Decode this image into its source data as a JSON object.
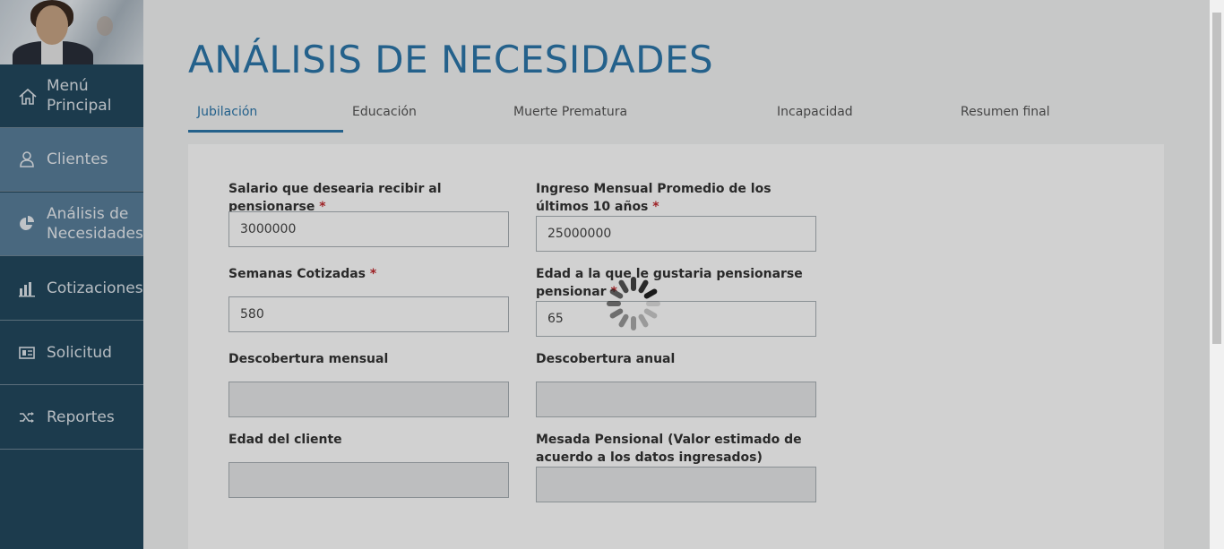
{
  "sidebar": {
    "items": [
      {
        "label": "Menú Principal",
        "icon": "home-icon"
      },
      {
        "label": "Clientes",
        "icon": "user-icon"
      },
      {
        "label": "Análisis de Necesidades",
        "icon": "pie-chart-icon"
      },
      {
        "label": "Cotizaciones",
        "icon": "bar-chart-icon"
      },
      {
        "label": "Solicitud",
        "icon": "form-icon"
      },
      {
        "label": "Reportes",
        "icon": "shuffle-icon"
      }
    ]
  },
  "page": {
    "title": "ANÁLISIS DE NECESIDADES"
  },
  "tabs": [
    {
      "label": "Jubilación",
      "active": true
    },
    {
      "label": "Educación",
      "active": false
    },
    {
      "label": "Muerte Prematura",
      "active": false
    },
    {
      "label": "Incapacidad",
      "active": false
    },
    {
      "label": "Resumen final",
      "active": false
    }
  ],
  "form": {
    "required_mark": "*",
    "salario": {
      "label": "Salario que desearia recibir al pensionarse",
      "value": "3000000"
    },
    "ingreso": {
      "label": "Ingreso Mensual Promedio de los últimos 10 años",
      "value": "25000000"
    },
    "semanas": {
      "label": "Semanas Cotizadas",
      "value": "580"
    },
    "edad_pension": {
      "label": "Edad a la que le gustaria pensionarse pensionar",
      "value": "65"
    },
    "desc_mensual": {
      "label": "Descobertura mensual",
      "value": ""
    },
    "desc_anual": {
      "label": "Descobertura anual",
      "value": ""
    },
    "edad_cliente": {
      "label": "Edad del cliente",
      "value": ""
    },
    "mesada": {
      "label": "Mesada Pensional (Valor estimado de acuerdo a los datos ingresados)",
      "value": ""
    }
  },
  "colors": {
    "accent": "#2d77aa",
    "sidebar": "#23485f",
    "sidebar_active": "#5a7f9c",
    "required": "#c0282d"
  },
  "loading": {
    "icon": "loading-spinner-icon"
  }
}
